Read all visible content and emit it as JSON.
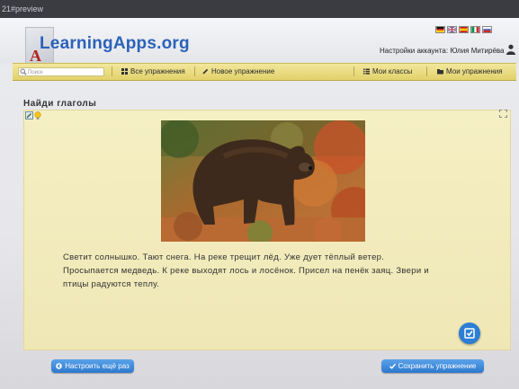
{
  "browser": {
    "address_fragment": "21#preview"
  },
  "header": {
    "logo_text": "LearningApps.org",
    "account_label": "Настройки аккаунта: Юлия Митирёва",
    "flags": [
      "german-flag",
      "uk-flag",
      "spain-flag",
      "italy-flag",
      "russia-flag"
    ]
  },
  "nav": {
    "search_placeholder": "Поиск",
    "all_exercises": "Все упражнения",
    "new_exercise": "Новое упражнение",
    "my_classes": "Мои классы",
    "my_exercises": "Мои упражнения"
  },
  "exercise": {
    "title": "Найди глаголы",
    "image": "bear-photo",
    "text_lines": [
      "Светит солнышко. Тают снега. На реке трещит лёд. Уже дует тёплый ветер.",
      "Просыпается медведь. К реке выходят лось и лосёнок. Присел на пенёк заяц. Звери и",
      "птицы радуются теплу."
    ]
  },
  "footer": {
    "retry_label": "Настроить ещё раз",
    "save_label": "Сохранить упражнение"
  },
  "colors": {
    "nav_yellow": "#e8d978",
    "content_bg": "#f3ecbf",
    "button_blue": "#2d78cf",
    "logo_blue": "#2b62b9"
  }
}
